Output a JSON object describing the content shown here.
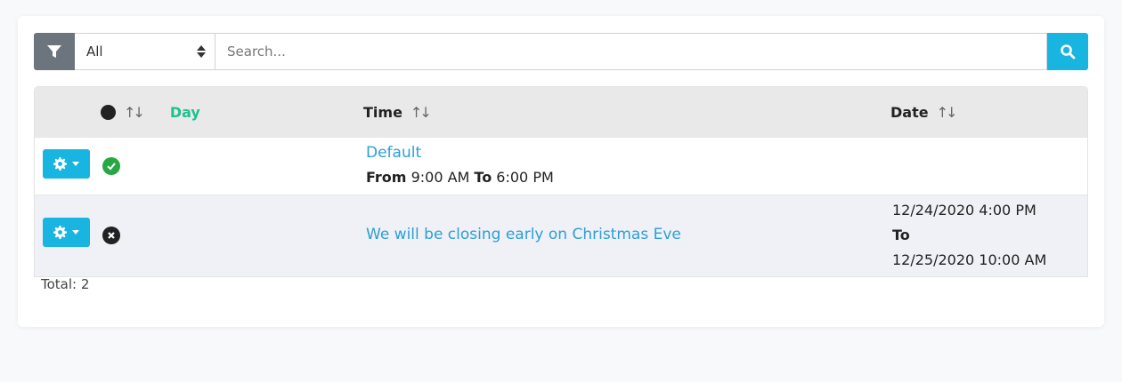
{
  "toolbar": {
    "filter_select_value": "All",
    "search_placeholder": "Search..."
  },
  "table": {
    "headers": {
      "day": "Day",
      "time": "Time",
      "date": "Date"
    },
    "rows": [
      {
        "status": "active",
        "title": "Default",
        "from_label": "From",
        "from_time": "9:00 AM",
        "to_label": "To",
        "to_time": "6:00 PM",
        "date_start": "",
        "date_to": "",
        "date_end": ""
      },
      {
        "status": "inactive",
        "title": "We will be closing early on Christmas Eve",
        "date_start": "12/24/2020 4:00 PM",
        "date_to": "To",
        "date_end": "12/25/2020 10:00 AM"
      }
    ]
  },
  "footer": {
    "total": "Total: 2"
  },
  "colors": {
    "accent": "#17b5e0",
    "day_header": "#20c08f",
    "link": "#2a9fd6",
    "success": "#28a745",
    "filter_btn": "#6c757d"
  },
  "icons": {
    "filter": "filter-icon",
    "search": "search-icon",
    "gear": "gear-icon",
    "sort": "sort-icon",
    "check": "check-circle-icon",
    "cross": "x-circle-icon"
  }
}
